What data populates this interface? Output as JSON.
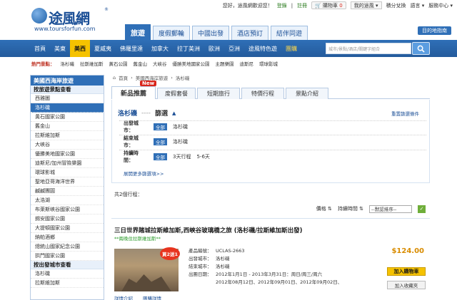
{
  "topbar": {
    "greeting": "您好，途風網歡迎您！",
    "login": "登錄",
    "register": "註冊",
    "cart": "購物車",
    "cart_count": "0",
    "my_account": "我的途風",
    "points": "積分兌換",
    "language": "語言",
    "help": "服務中心"
  },
  "logo": {
    "brand": "途風網",
    "url": "www.toursforfun.com"
  },
  "main_tabs": [
    "旅遊",
    "度假郵輪",
    "中國出發",
    "酒店預訂",
    "結伴同遊"
  ],
  "dest_map": "目的地指南",
  "nav": {
    "items": [
      "首頁",
      "美東",
      "美西",
      "夏威夷",
      "佛羅里達",
      "加拿大",
      "拉丁美洲",
      "歐洲",
      "亞洲",
      "途風特色遊",
      "團購"
    ],
    "active": "美西",
    "search_placeholder": "城市/景點/酒店/關鍵字組合"
  },
  "hot": {
    "title": "熱門景點：",
    "items": [
      "洛杉磯",
      "拉斯維加斯",
      "黃石公園",
      "舊金山",
      "大峽谷",
      "優勝美地國家公園",
      "主題樂園",
      "迪斯尼",
      "環球影城"
    ]
  },
  "sidebar": {
    "header": "美國西海岸旅遊",
    "sub1": "按旅遊景點查看",
    "items": [
      "西雅圖",
      "洛杉磯",
      "黃石國家公園",
      "舊金山",
      "拉斯維加斯",
      "大峽谷",
      "優勝美地國家公園",
      "迪斯尼/加州冒險樂園",
      "環球影城",
      "聖地亞哥海洋世界",
      "鹹鹹團圓",
      "太浩湖",
      "布萊斯峽谷國家公園",
      "錫安國家公園",
      "大提頓國家公園",
      "納帕酒鄉",
      "總統山國家紀念公園",
      "拱門國家公園"
    ],
    "active": "洛杉磯",
    "sub2": "按出發城市查看",
    "items2": [
      "洛杉磯",
      "拉斯維加斯"
    ]
  },
  "breadcrumb": [
    "首頁",
    "美國西海岸旅遊",
    "洛杉磯"
  ],
  "product_tabs": [
    "新品推薦",
    "度假套餐",
    "短期旅行",
    "特價行程",
    "景點介紹"
  ],
  "new_tag": "New",
  "filter": {
    "city": "洛杉磯",
    "dash": "----",
    "filter_label": "篩選",
    "reset": "重置篩選條件",
    "rows": [
      {
        "label": "出發城市：",
        "all": "全部",
        "values": [
          "洛杉磯"
        ]
      },
      {
        "label": "結束城市：",
        "all": "全部",
        "values": [
          "洛杉磯"
        ]
      },
      {
        "label": "持續時間：",
        "all": "全部",
        "values": [
          "3天行程",
          "5-6天"
        ]
      }
    ],
    "more": "展開更多篩選項>>"
  },
  "results": {
    "count_text": "共2個行程："
  },
  "sort": {
    "price": "價格",
    "duration": "持續時間",
    "select": "--默認排序--"
  },
  "product": {
    "title": "三日世界賭城拉斯維加斯,西峽谷玻璃橋之旅 (洛杉磯/拉斯維加斯出發)",
    "from": "**兩晚住拉斯維加斯**",
    "badge": "買2送1",
    "code_label": "產品編號：",
    "code": "UCLAS-2663",
    "depart_label": "出發城市：",
    "depart": "洛杉磯",
    "end_label": "結束城市：",
    "end": "洛杉磯",
    "date_label": "出團日期：",
    "date_line1": "2012年1月1日 - 2013年3月31日：周日/周三/周六",
    "date_line2": "2012年08月12日、2012年09月01日、2012年09月02日、",
    "price": "$124.00",
    "buy": "加入購物車",
    "fav": "加入收藏夾",
    "link1": "詳情介紹",
    "link2": "團購詳情"
  }
}
